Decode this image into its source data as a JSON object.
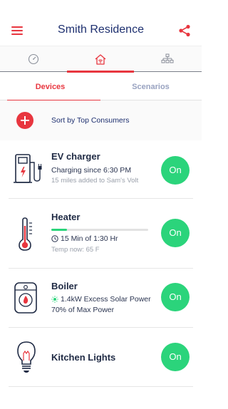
{
  "header": {
    "title": "Smith Residence"
  },
  "icon_tabs": [
    {
      "icon": "gauge-icon"
    },
    {
      "icon": "home-wifi-icon",
      "active": true
    },
    {
      "icon": "network-hierarchy-icon"
    }
  ],
  "tabs": {
    "devices": "Devices",
    "scenarios": "Scenarios",
    "active": "Devices"
  },
  "sort": {
    "label": "Sort by Top Consumers"
  },
  "devices": [
    {
      "name": "EV charger",
      "icon": "ev-charger-icon",
      "line1": "Charging since 6:30 PM",
      "line2": "15 miles added to Sam's Volt",
      "button": "On"
    },
    {
      "name": "Heater",
      "icon": "thermometer-icon",
      "progress": 0.16,
      "line1": "15 Min of 1:30 Hr",
      "line2": "Temp now: 65 F",
      "button": "On"
    },
    {
      "name": "Boiler",
      "icon": "boiler-icon",
      "line1": "1.4kW Excess Solar Power",
      "line2": "70% of Max Power",
      "button": "On"
    },
    {
      "name": "Kitchen Lights",
      "icon": "light-bulb-icon",
      "button": "On"
    }
  ],
  "colors": {
    "accent": "#e8363f",
    "on": "#2bd47b",
    "navy": "#1d2f6f"
  }
}
